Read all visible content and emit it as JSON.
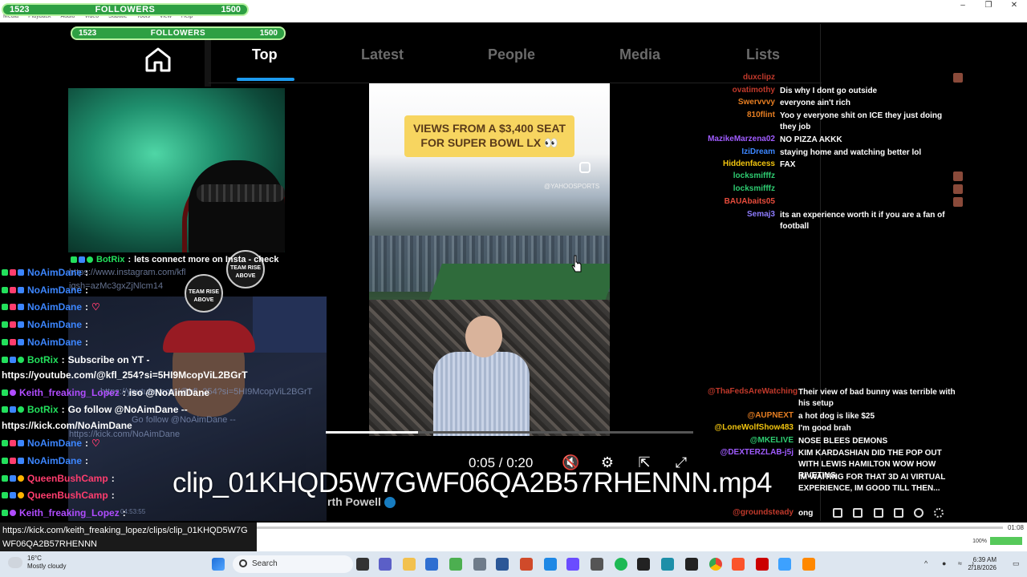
{
  "window": {
    "menu": [
      "Media",
      "Playback",
      "Audio",
      "Video",
      "Subtitle",
      "Tools",
      "View",
      "Help"
    ],
    "controls": [
      "–",
      "❐",
      "✕"
    ]
  },
  "followers_top": {
    "start": "1523",
    "label": "FOLLOWERS",
    "goal": "1500"
  },
  "followers_inner": {
    "start": "1523",
    "label": "FOLLOWERS",
    "goal": "1500"
  },
  "tabs": {
    "items": [
      "Top",
      "Latest",
      "People",
      "Media",
      "Lists"
    ],
    "active": "Top"
  },
  "badges": [
    "TEAM RISE ABOVE",
    "TEAM RISE ABOVE"
  ],
  "left_chat": {
    "rows": [
      {
        "name": "BotRix",
        "sep": ":",
        "msg": "lets connect more on Insta - check"
      },
      {
        "name": "NoAimDane",
        "sep": ":",
        "msg": ""
      },
      {
        "name": "NoAimDane",
        "sep": ":",
        "msg": ""
      },
      {
        "name": "NoAimDane",
        "sep": ":",
        "msg": "♡"
      },
      {
        "name": "NoAimDane",
        "sep": ":",
        "msg": ""
      },
      {
        "name": "NoAimDane",
        "sep": ":",
        "msg": ""
      },
      {
        "name": "BotRix",
        "sep": ":",
        "msg": "Subscribe on YT -"
      },
      {
        "name": "Keith_freaking_Lopez",
        "sep": ":",
        "msg": "iso @NoAimDane"
      },
      {
        "name": "BotRix",
        "sep": ":",
        "msg": "Go follow @NoAimDane --"
      },
      {
        "name": "NoAimDane",
        "sep": ":",
        "msg": "♡"
      },
      {
        "name": "NoAimDane",
        "sep": ":",
        "msg": ""
      },
      {
        "name": "QueenBushCamp",
        "sep": ":",
        "msg": ""
      },
      {
        "name": "QueenBushCamp",
        "sep": ":",
        "msg": ""
      },
      {
        "name": "Keith_freaking_Lopez",
        "sep": ":",
        "msg": ""
      }
    ],
    "url_yt": "https://youtube.com/@kfl_254?si=5HI9McopViL2BGrT",
    "url_kick": "https://kick.com/NoAimDane",
    "ghost_insta": "https://www.instagram.com/kfl",
    "ghost_igsh": "igsh=azMc3gxZjNlcm14",
    "ghost_yt": "https://youtube.com/@kfl_254?si=5HI9McopViL2BGrT",
    "ghost_follow": "Go follow @NoAimDane --",
    "ghost_kick": "https://kick.com/NoAimDane",
    "ghost_time": "04:53:55"
  },
  "video": {
    "sign_line1": "VIEWS FROM A $3,400 SEAT",
    "sign_line2": "FOR SUPER BOWL LX 👀",
    "watermark": "@YAHOOSPORTS",
    "current_time": "0:05",
    "duration": "0:20",
    "time_display": "0:05 / 0:20",
    "progress": 0.25,
    "author": "rth Powell",
    "clip_title": "clip_01KHQD5W7GWF06QA2B57RHENNN.mp4"
  },
  "right_chat": [
    {
      "name": "duxclipz",
      "msg": "",
      "color": "#c0392b"
    },
    {
      "name": "ovatimothy",
      "msg": "Dis why I dont go outside",
      "color": "#c0392b"
    },
    {
      "name": "Swervvvy",
      "msg": "everyone ain't rich",
      "color": "#e67e22"
    },
    {
      "name": "810flint",
      "msg": "Yoo y everyone shit on ICE they just doing they job",
      "color": "#e67e22"
    },
    {
      "name": "MazikeMarzena02",
      "msg": "NO PIZZA AKKK",
      "color": "#a05cff"
    },
    {
      "name": "IziDream",
      "msg": "staying home and watching better lol",
      "color": "#3c86ff"
    },
    {
      "name": "Hiddenfacess",
      "msg": "FAX",
      "color": "#f1c40f"
    },
    {
      "name": "locksmifffz",
      "msg": "",
      "color": "#2ecc71"
    },
    {
      "name": "locksmifffz",
      "msg": "",
      "color": "#2ecc71"
    },
    {
      "name": "BAUAbaits05",
      "msg": "",
      "color": "#e74c3c"
    },
    {
      "name": "Semaj3",
      "msg": "its an experience worth it if you are a fan of football",
      "color": "#8e7cff"
    }
  ],
  "right_chat2": [
    {
      "name": "@ThaFedsAreWatching",
      "msg": "Their view of bad bunny was terrible with his setup",
      "color": "#c0392b"
    },
    {
      "name": "@AUPNEXT",
      "msg": "a hot dog is like $25",
      "color": "#e67e22"
    },
    {
      "name": "@LoneWolfShow483",
      "msg": "I'm good brah",
      "color": "#f1c40f"
    },
    {
      "name": "@MKELIVE",
      "msg": "NOSE BLEES DEMONS",
      "color": "#2ecc71"
    },
    {
      "name": "@DEXTERZLAB-j5j",
      "msg": "KIM KARDASHIAN DID THE POP OUT WITH LEWIS HAMILTON WOW HOW RIVETING",
      "color": "#a05cff"
    },
    {
      "name": "",
      "msg": "IM WAITING FOR THAT 3D AI VIRTUAL EXPERIENCE, IM GOOD TILL THEN...",
      "color": "#3c86ff"
    },
    {
      "name": "@groundsteady",
      "msg": "ong",
      "color": "#c0392b"
    }
  ],
  "bottom": {
    "url_line": "https://kick.com/keith_freaking_lopez/clips/clip_01KHQD5W7GWF06QA2B57RHENNN",
    "elapsed": "01:08",
    "volume_label": "100%",
    "volume": 1.0
  },
  "taskbar": {
    "temp": "16°C",
    "weather": "Mostly cloudy",
    "search": "Search",
    "time": "6:39 AM",
    "date": "2/18/2026"
  },
  "colors": {
    "accent": "#1d9bf0",
    "follower_bar": "#2ea043",
    "kick_green": "#23e05c"
  }
}
